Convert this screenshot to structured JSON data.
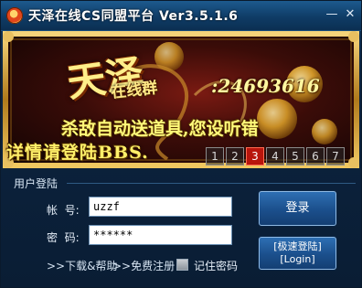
{
  "window": {
    "title": "天泽在线CS同盟平台 Ver3.5.1.6",
    "minimize_glyph": "—",
    "close_glyph": "✕"
  },
  "banner": {
    "qq_group_big": "天泽",
    "qq_group_small": "在线群",
    "qq_number": ":24693616",
    "line1": "杀敌自动送道具,您设听错",
    "line2": "详情请登陆BBS.",
    "pages": [
      "1",
      "2",
      "3",
      "4",
      "5",
      "6",
      "7"
    ],
    "active_page": "3"
  },
  "login": {
    "group_label": "用户登陆",
    "account_label": "帐  号:",
    "password_label": "密  码:",
    "account_value": "uzzf",
    "password_value": "******",
    "login_button": "登录",
    "quick_login_line1": "[极速登陆]",
    "quick_login_line2": "[Login]",
    "help_link": ">>下载&帮助",
    "register_link": ">>免费注册",
    "remember_label": "记住密码"
  },
  "colors": {
    "title_bar": "#0f3c66",
    "background": "#0c2440",
    "button": "#1b4f8c",
    "banner_gold": "#ffd95a",
    "active_page": "#b8150c"
  }
}
